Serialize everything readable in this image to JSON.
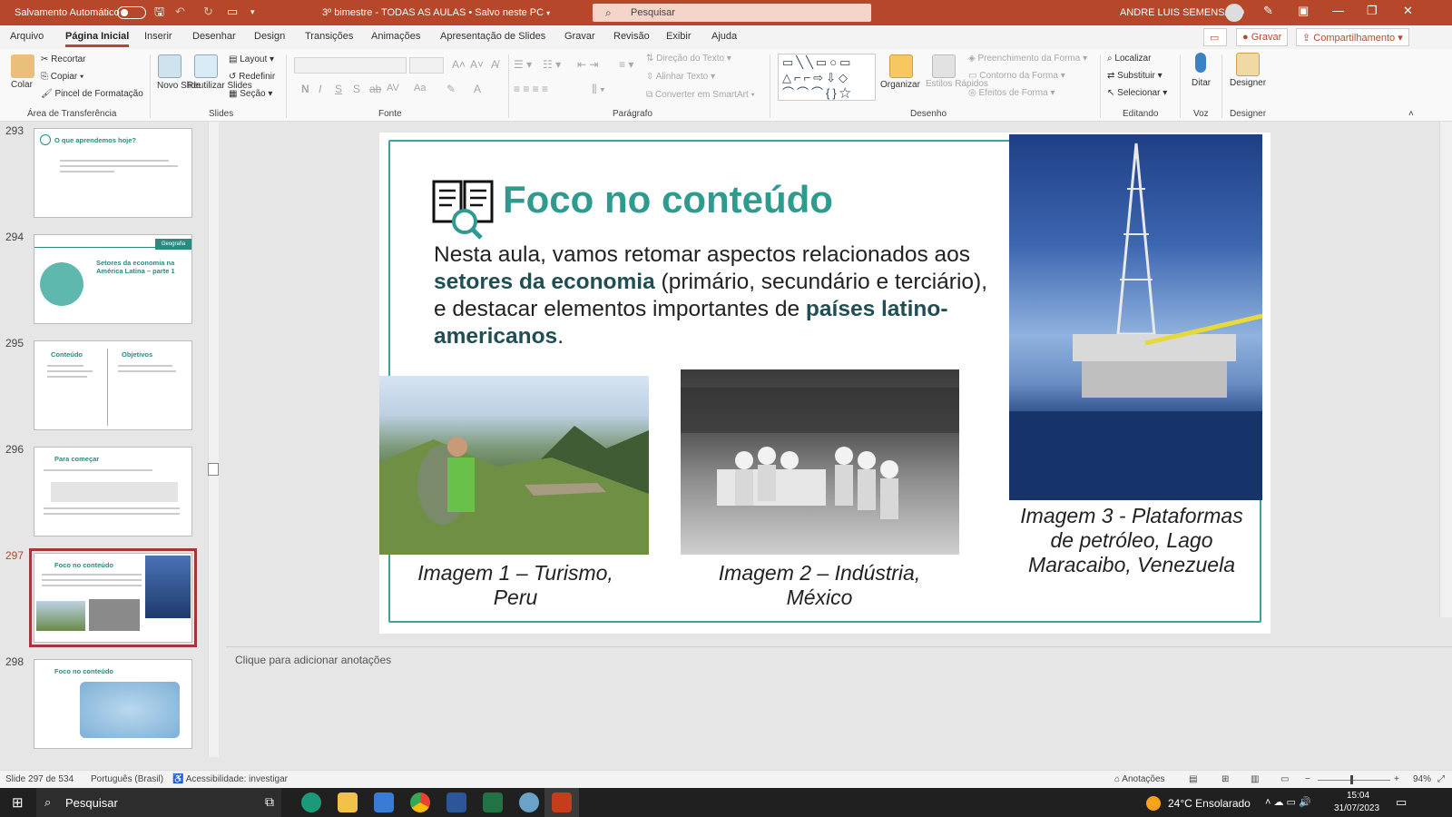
{
  "titlebar": {
    "autosave_label": "Salvamento Automático",
    "document_title": "3º bimestre - TODAS AS AULAS",
    "save_status": "Salvo neste PC",
    "search_placeholder": "Pesquisar",
    "user_name": "ANDRE LUIS SEMENSATO"
  },
  "menu": {
    "tabs": [
      "Arquivo",
      "Página Inicial",
      "Inserir",
      "Desenhar",
      "Design",
      "Transições",
      "Animações",
      "Apresentação de Slides",
      "Gravar",
      "Revisão",
      "Exibir",
      "Ajuda"
    ],
    "record_button": "Gravar",
    "share_button": "Compartilhamento"
  },
  "ribbon": {
    "clipboard": {
      "group": "Área de Transferência",
      "paste": "Colar",
      "cut": "Recortar",
      "copy": "Copiar",
      "format_painter": "Pincel de Formatação"
    },
    "slides": {
      "group": "Slides",
      "new_slide": "Novo Slide",
      "reuse": "Reutilizar Slides",
      "layout": "Layout",
      "reset": "Redefinir",
      "section": "Seção"
    },
    "font": {
      "group": "Fonte"
    },
    "paragraph": {
      "group": "Parágrafo",
      "text_direction": "Direção do Texto",
      "align_text": "Alinhar Texto",
      "smartart": "Converter em SmartArt"
    },
    "drawing": {
      "group": "Desenho",
      "arrange": "Organizar",
      "quick_styles": "Estilos Rápidos",
      "fill": "Preenchimento da Forma",
      "outline": "Contorno da Forma",
      "effects": "Efeitos de Forma"
    },
    "editing": {
      "group": "Editando",
      "find": "Localizar",
      "replace": "Substituir",
      "select": "Selecionar"
    },
    "voice": {
      "group": "Voz",
      "dictate": "Ditar"
    },
    "designer": {
      "group": "Designer",
      "label": "Designer"
    }
  },
  "thumbnails": [
    {
      "number": "293",
      "title": "O que aprendemos hoje?"
    },
    {
      "number": "294",
      "title": "Setores da economia na América Latina – parte 1",
      "badge": "Geografia"
    },
    {
      "number": "295",
      "title": "Conteúdo",
      "title2": "Objetivos"
    },
    {
      "number": "296",
      "title": "Para começar"
    },
    {
      "number": "297",
      "title": "Foco no conteúdo"
    },
    {
      "number": "298",
      "title": "Foco no conteúdo"
    }
  ],
  "slide": {
    "heading": "Foco no conteúdo",
    "para_before": "Nesta aula, vamos retomar aspectos relacionados aos ",
    "para_bold1": "setores da economia",
    "para_middle": " (primário, secundário e terciário), e destacar elementos importantes de ",
    "para_bold2": "países latino-americanos",
    "para_end": ".",
    "caption1": "Imagem 1 – Turismo, Peru",
    "caption2": "Imagem 2 – Indústria, México",
    "caption3": "Imagem 3 - Plataformas de petróleo, Lago Maracaibo, Venezuela"
  },
  "notes_placeholder": "Clique para adicionar anotações",
  "statusbar": {
    "slide_counter": "Slide 297 de 534",
    "language": "Português (Brasil)",
    "accessibility": "Acessibilidade: investigar",
    "notes": "Anotações",
    "zoom": "94%"
  },
  "taskbar": {
    "search": "Pesquisar",
    "weather": "24°C Ensolarado",
    "time": "15:04",
    "date": "31/07/2023"
  },
  "colors": {
    "accent": "#b7472a",
    "teal": "#2f9b8f",
    "dark_teal": "#1f4f55"
  }
}
